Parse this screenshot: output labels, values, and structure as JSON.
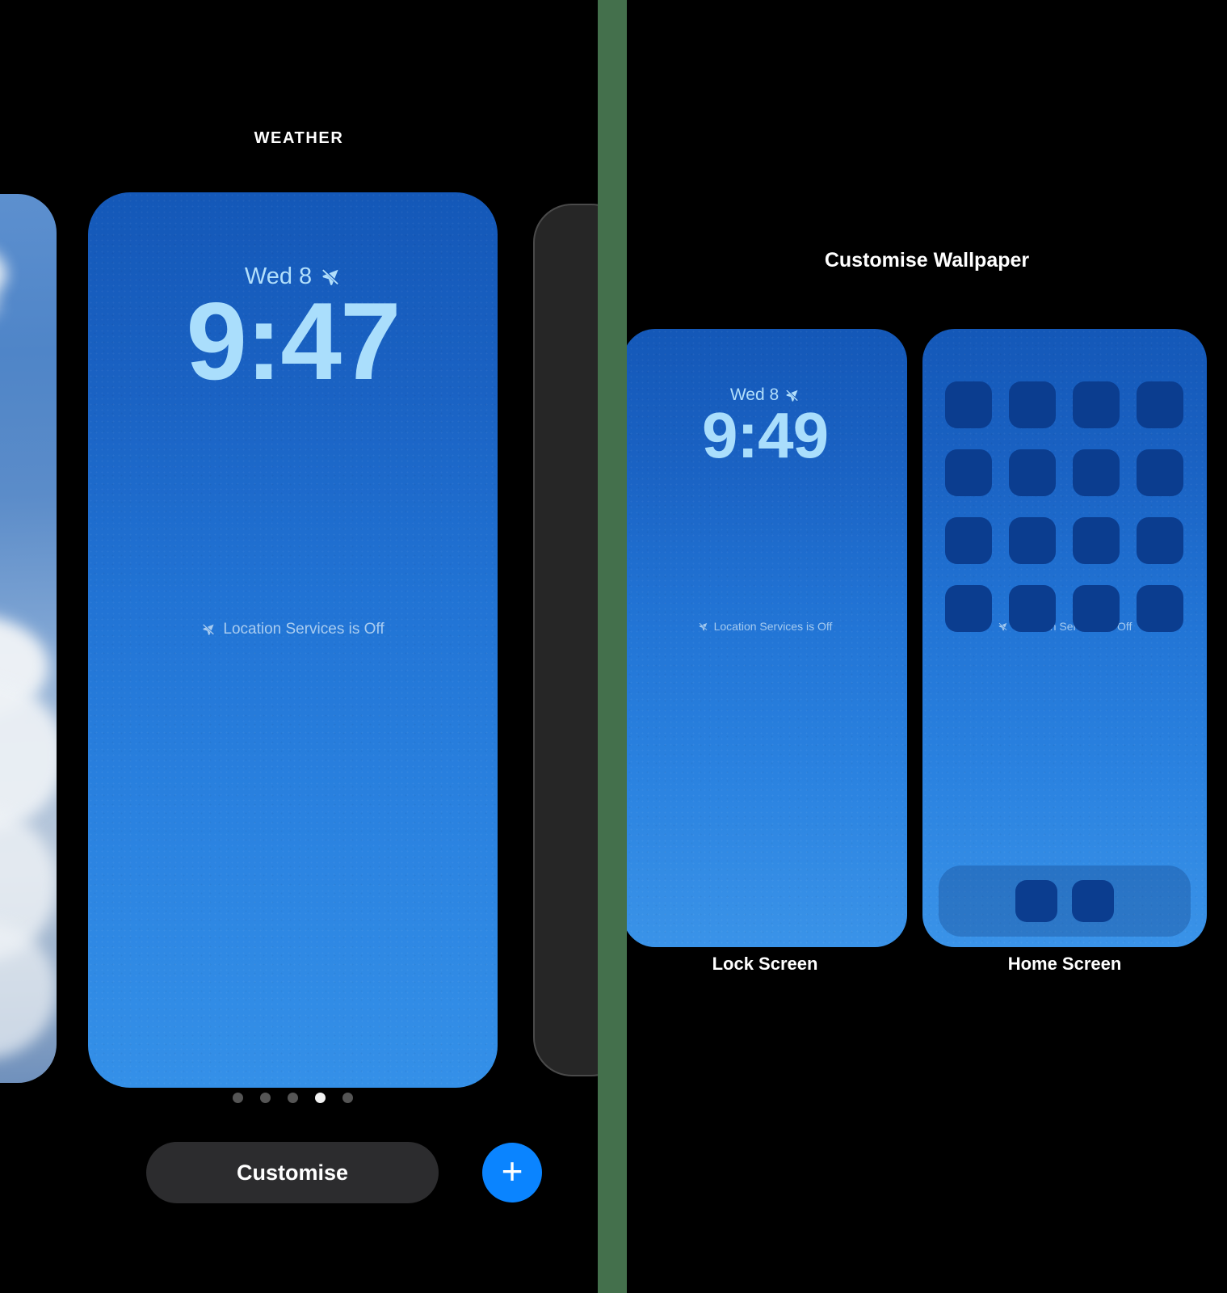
{
  "left_panel": {
    "gallery_title": "WEATHER",
    "main_preview": {
      "date": "Wed 8",
      "time": "9:47",
      "status_text": "Location Services is Off",
      "status_icon": "location-slash-icon",
      "date_icon": "location-slash-icon",
      "background_top_color": "#1458b8",
      "background_bottom_color": "#3490e8",
      "time_color": "#aadefc"
    },
    "page_dots": {
      "count": 5,
      "active_index": 3,
      "active_color": "#f2f2f2",
      "inactive_color": "#555555"
    },
    "customise_button_label": "Customise",
    "add_button_icon": "plus-icon",
    "add_button_color": "#0a84ff",
    "neighbor_cards": [
      {
        "name": "clouds-wallpaper-card"
      },
      {
        "name": "add-new-wallpaper-card"
      }
    ]
  },
  "divider": {
    "color": "#44704c"
  },
  "right_panel": {
    "title": "Customise Wallpaper",
    "lock_screen": {
      "label": "Lock Screen",
      "date": "Wed 8",
      "time": "9:49",
      "status_text": "Location Services is Off",
      "status_icon": "location-slash-icon",
      "date_icon": "location-slash-icon"
    },
    "home_screen": {
      "label": "Home Screen",
      "status_text": "Location Services is Off",
      "status_icon": "location-slash-icon",
      "app_icon_count": 16,
      "dock_icon_count": 2
    }
  }
}
